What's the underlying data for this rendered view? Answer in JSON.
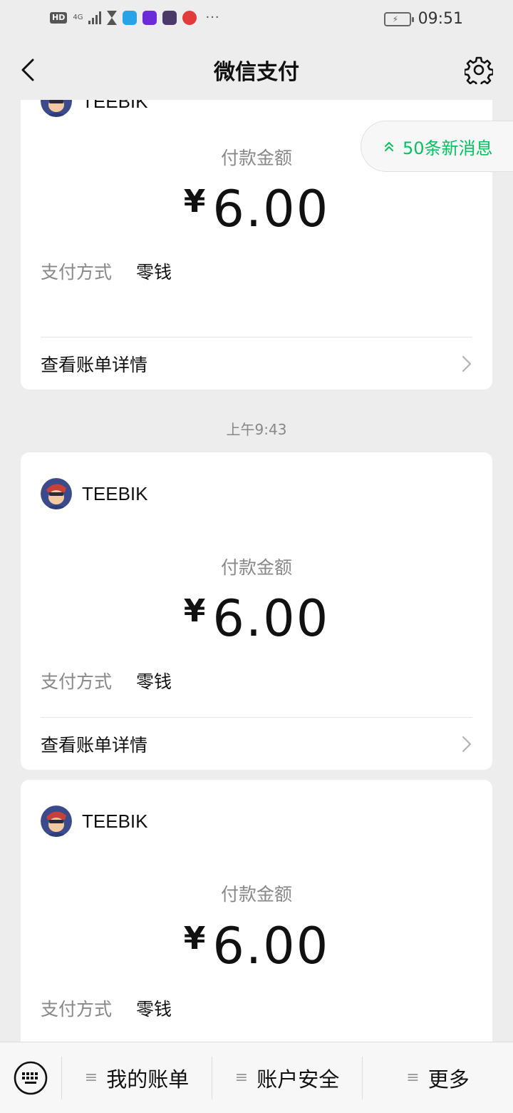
{
  "status_bar": {
    "hd": "HD",
    "network": "4G",
    "more": "···",
    "time": "09:51"
  },
  "header": {
    "title": "微信支付"
  },
  "new_messages": {
    "label": "50条新消息"
  },
  "cards": [
    {
      "merchant": "TEEBIK",
      "amount_label": "付款金额",
      "currency": "¥",
      "amount": "6.00",
      "pay_method_label": "支付方式",
      "pay_method": "零钱",
      "detail_link": "查看账单详情"
    },
    {
      "merchant": "TEEBIK",
      "amount_label": "付款金额",
      "currency": "¥",
      "amount": "6.00",
      "pay_method_label": "支付方式",
      "pay_method": "零钱",
      "detail_link": "查看账单详情"
    },
    {
      "merchant": "TEEBIK",
      "amount_label": "付款金额",
      "currency": "¥",
      "amount": "6.00",
      "pay_method_label": "支付方式",
      "pay_method": "零钱"
    }
  ],
  "timestamp": "上午9:43",
  "bottom_menu": {
    "items": [
      {
        "label": "我的账单",
        "icon": "menu-lines-icon"
      },
      {
        "label": "账户安全",
        "icon": "menu-lines-icon"
      },
      {
        "label": "更多",
        "icon": "menu-lines-icon"
      }
    ]
  },
  "colors": {
    "accent": "#07c160",
    "background": "#ededed",
    "card": "#ffffff"
  }
}
